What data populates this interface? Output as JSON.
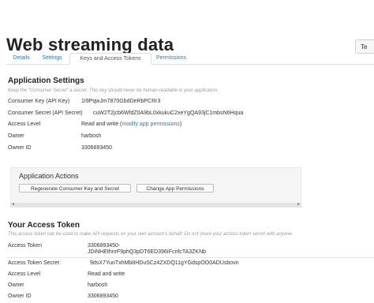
{
  "page_title": "Web streaming data",
  "top_button": "Te",
  "tabs": [
    {
      "label": "Details"
    },
    {
      "label": "Settings"
    },
    {
      "label": "Keys and Access Tokens"
    },
    {
      "label": "Permissions"
    }
  ],
  "app_settings": {
    "title": "Application Settings",
    "note": "Keep the \"Consumer Secret\" a secret. This key should never be human-readable in your application.",
    "rows": [
      {
        "label": "Consumer Key (API Key)",
        "value": "1I9PqwJm7870GbdDeRbPCRr3"
      },
      {
        "label": "Consumer Secret (API Secret)",
        "value": "cuW2T2jcb6WfdZ0A9bL0xkukuC2xeYgQA93jC1mbsN6Hqua"
      },
      {
        "label": "Access Level",
        "value": "Read and write (",
        "link": "modify app permissions",
        "tail": ")"
      },
      {
        "label": "Owner",
        "value": "harbosh"
      },
      {
        "label": "Owner ID",
        "value": "3306893450"
      }
    ]
  },
  "app_actions": {
    "title": "Application Actions",
    "regenerate": "Regenerate Consumer Key and Secret",
    "change_permissions": "Change App Permissions"
  },
  "access_token": {
    "title": "Your Access Token",
    "note": "This access token can be used to make API requests on your own account's behalf. Do not share your access token secret with anyone.",
    "rows": [
      {
        "label": "Access Token",
        "value": "3306893450-",
        "value2": "JDiNHEthnrF9phQ3pDT6ED396IFcnfcTA3ZKNb"
      },
      {
        "label": "Access Token Secret",
        "value": "9dsX7YuoTxhMb8HDuSCz4ZXDQ11gYGdspOO0ADUsbovn"
      },
      {
        "label": "Access Level",
        "value": "Read and write"
      },
      {
        "label": "Owner",
        "value": "harbosh"
      },
      {
        "label": "Owner ID",
        "value": "3306893450"
      }
    ]
  }
}
